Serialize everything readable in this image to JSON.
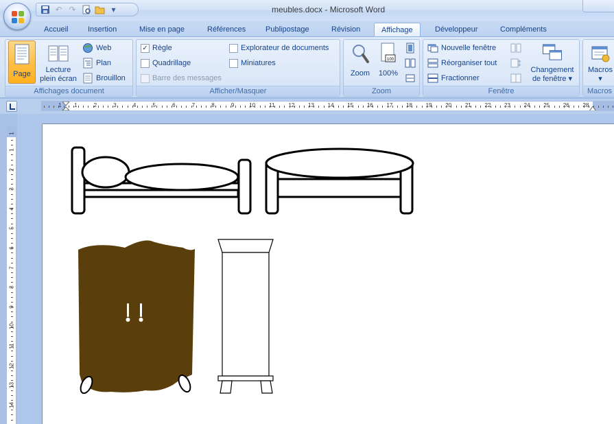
{
  "window": {
    "title": "meubles.docx - Microsoft Word"
  },
  "quick_access": {
    "icons": [
      "save-icon",
      "undo-icon",
      "redo-icon",
      "print-preview-icon",
      "open-folder-icon",
      "customize-qat-icon"
    ]
  },
  "tabs": [
    "Accueil",
    "Insertion",
    "Mise en page",
    "Références",
    "Publipostage",
    "Révision",
    "Affichage",
    "Développeur",
    "Compléments"
  ],
  "active_tab": "Affichage",
  "ribbon": {
    "affichages_document": {
      "label": "Affichages document",
      "page": "Page",
      "lecture_line1": "Lecture",
      "lecture_line2": "plein écran",
      "web": "Web",
      "plan": "Plan",
      "brouillon": "Brouillon"
    },
    "afficher_masquer": {
      "label": "Afficher/Masquer",
      "regle": {
        "label": "Règle",
        "checked": true
      },
      "quadrillage": {
        "label": "Quadrillage",
        "checked": false
      },
      "barre_messages": {
        "label": "Barre des messages",
        "checked": false,
        "disabled": true
      },
      "explorateur": {
        "label": "Explorateur de documents",
        "checked": false
      },
      "miniatures": {
        "label": "Miniatures",
        "checked": false
      }
    },
    "zoom": {
      "label": "Zoom",
      "zoom_btn": "Zoom",
      "percent_btn": "100%"
    },
    "fenetre": {
      "label": "Fenêtre",
      "nouvelle": "Nouvelle fenêtre",
      "reorganiser": "Réorganiser tout",
      "fractionner": "Fractionner",
      "changement_line1": "Changement",
      "changement_line2": "de fenêtre ▾"
    },
    "macros": {
      "label": "Macros",
      "btn": "Macros",
      "arrow": "▾"
    }
  },
  "ruler": {
    "h_numbers": [
      "1",
      "1",
      "2",
      "3",
      "4",
      "5",
      "6",
      "7",
      "8",
      "9",
      "10",
      "11",
      "12",
      "13",
      "14",
      "15",
      "16",
      "17",
      "18",
      "19",
      "20",
      "21",
      "22",
      "23",
      "24",
      "25",
      "26",
      "28"
    ],
    "v_numbers": [
      "1",
      "1",
      "2",
      "3",
      "4",
      "5",
      "6",
      "7",
      "8",
      "9",
      "10",
      "11",
      "12",
      "13",
      "14"
    ]
  },
  "colors": {
    "wardrobe_fill": "#5a3e0c",
    "accent_tab_border": "#8db2e3",
    "active_button": "#ffc049"
  }
}
